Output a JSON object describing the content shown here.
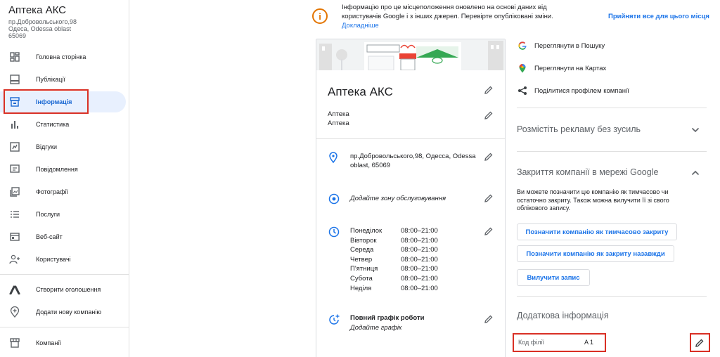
{
  "business": {
    "name": "Аптека АКС",
    "address_lines": [
      "пр.Добровольського,98",
      "Одеса, Odessa oblast",
      "65069"
    ]
  },
  "nav": [
    {
      "label": "Головна сторінка",
      "icon": "grid-icon"
    },
    {
      "label": "Публікації",
      "icon": "post-icon"
    },
    {
      "label": "Інформація",
      "icon": "storefront-icon"
    },
    {
      "label": "Статистика",
      "icon": "bar-chart-icon"
    },
    {
      "label": "Відгуки",
      "icon": "review-icon"
    },
    {
      "label": "Повідомлення",
      "icon": "message-icon"
    },
    {
      "label": "Фотографії",
      "icon": "photo-icon"
    },
    {
      "label": "Послуги",
      "icon": "list-icon"
    },
    {
      "label": "Веб-сайт",
      "icon": "website-icon"
    },
    {
      "label": "Користувачі",
      "icon": "add-user-icon"
    },
    {
      "label": "Створити оголошення",
      "icon": "ads-icon"
    },
    {
      "label": "Додати нову компанію",
      "icon": "add-location-icon"
    },
    {
      "label": "Компанії",
      "icon": "store-icon"
    }
  ],
  "notice": {
    "text": "Інформацію про це місцеположення оновлено на основі даних від користувачів Google і з інших джерел. Перевірте опубліковані зміни.",
    "link": "Докладніше",
    "accept": "Прийняти все для цього місця"
  },
  "card": {
    "title": "Аптека АКС",
    "categories": [
      "Аптека",
      "Аптека"
    ],
    "address": "пр.Добровольського,98, Одесса, Odessa oblast, 65069",
    "service_area": "Додайте зону обслуговування",
    "hours": [
      {
        "day": "Понеділок",
        "time": "08:00–21:00"
      },
      {
        "day": "Вівторок",
        "time": "08:00–21:00"
      },
      {
        "day": "Середа",
        "time": "08:00–21:00"
      },
      {
        "day": "Четвер",
        "time": "08:00–21:00"
      },
      {
        "day": "П'ятниця",
        "time": "08:00–21:00"
      },
      {
        "day": "Субота",
        "time": "08:00–21:00"
      },
      {
        "day": "Неділя",
        "time": "08:00–21:00"
      }
    ],
    "full_schedule_title": "Повний графік роботи",
    "full_schedule_sub": "Додайте графік"
  },
  "right": {
    "links": [
      "Переглянути в Пошуку",
      "Переглянути на Картах",
      "Поділитися профілем компанії"
    ],
    "ads_title": "Розмістіть рекламу без зусиль",
    "closing_title": "Закриття компанії в мережі Google",
    "closing_desc": "Ви можете позначити цю компанію як тимчасово чи остаточно закриту. Також можна вилучити її зі свого облікового запису.",
    "btn_temp": "Позначити компанію як тимчасово закриту",
    "btn_perm": "Позначити компанію як закриту назавжди",
    "btn_remove": "Вилучити запис",
    "extra_title": "Додаткова інформація",
    "branch_label": "Код філії",
    "branch_value": "A 1"
  },
  "colors": {
    "accent": "#1a73e8",
    "active_bg": "#e8f0fe",
    "warning": "#e37400",
    "highlight": "#d93025"
  }
}
